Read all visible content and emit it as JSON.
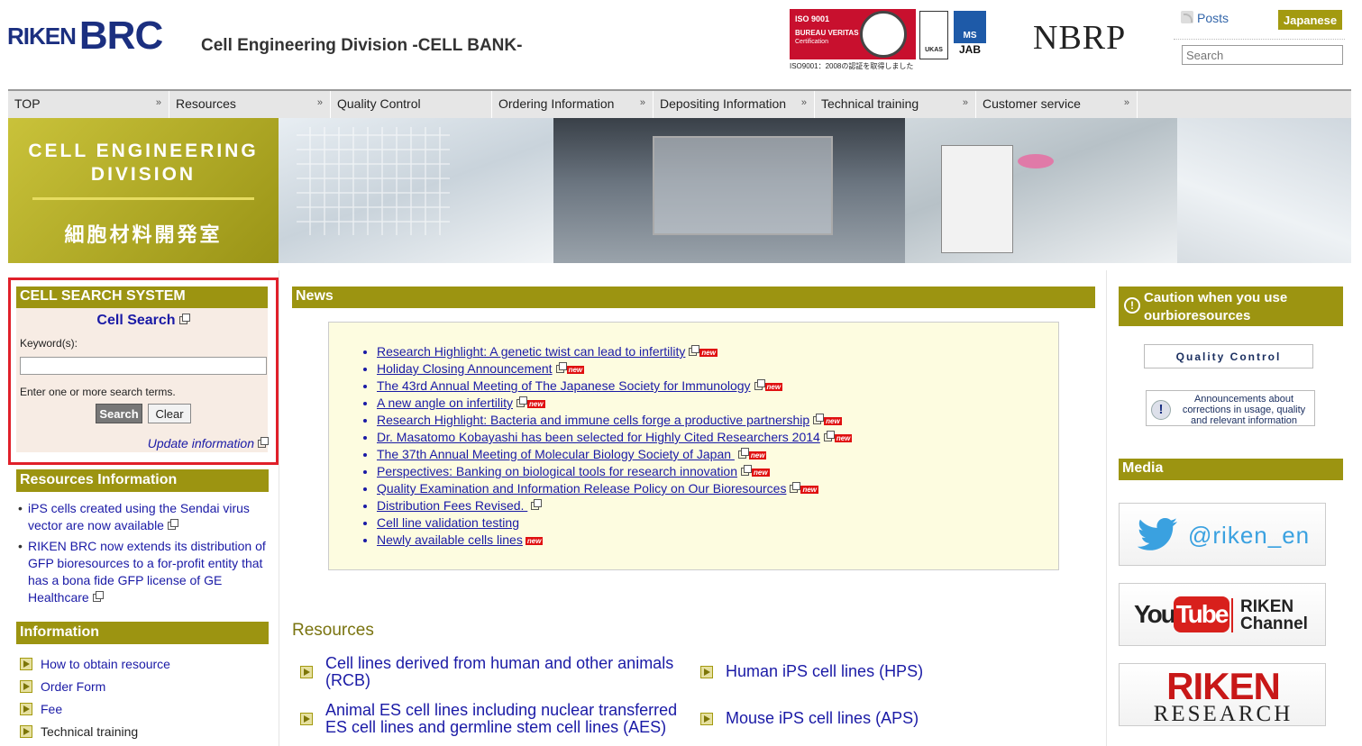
{
  "header": {
    "logo_riken": "RIKEN",
    "logo_brc": "BRC",
    "division": "Cell Engineering Division  -CELL BANK-",
    "cert": {
      "iso": "ISO 9001",
      "bv": "BUREAU VERITAS",
      "certification": "Certification",
      "ukas": "UKAS",
      "ms": "MS",
      "jab": "JAB",
      "caption": "ISO9001：2008の認証を取得しました"
    },
    "nbrp": "NBRP",
    "posts": "Posts",
    "japanese_button": "Japanese",
    "search_placeholder": "Search"
  },
  "nav": [
    "TOP",
    "Resources",
    "Quality Control",
    "Ordering Information",
    "Depositing Information",
    "Technical training",
    "Customer service"
  ],
  "banner": {
    "title_en_1": "CELL ENGINEERING",
    "title_en_2": "DIVISION",
    "title_jp": "細胞材料開発室"
  },
  "cell_search": {
    "heading": "CELL SEARCH SYSTEM",
    "title": "Cell Search",
    "keyword_label": "Keyword(s):",
    "keyword_value": "",
    "hint": "Enter one or more search terms.",
    "search_button": "Search",
    "clear_button": "Clear",
    "update_link": "Update information"
  },
  "resources_info": {
    "heading": "Resources Information",
    "items": [
      "iPS cells created using the Sendai virus vector are now available",
      "RIKEN BRC now extends its distribution of GFP bioresources to a for-profit entity that has a bona fide GFP license of GE Healthcare"
    ]
  },
  "information": {
    "heading": "Information",
    "items": [
      "How to obtain resource",
      "Order Form",
      "Fee",
      "Technical training"
    ]
  },
  "news": {
    "heading": "News",
    "new_badge": "new",
    "items": [
      {
        "text": "Research Highlight: A genetic twist can lead to infertility",
        "new": true
      },
      {
        "text": "Holiday Closing Announcement",
        "new": true
      },
      {
        "text": "The 43rd Annual Meeting of The Japanese Society for Immunology",
        "new": true
      },
      {
        "text": "A new angle on infertility",
        "new": true
      },
      {
        "text": "Research Highlight: Bacteria and immune cells forge a productive partnership",
        "new": true
      },
      {
        "text": "Dr. Masatomo Kobayashi has been selected for Highly Cited Researchers 2014",
        "new": true
      },
      {
        "text": "The 37th Annual Meeting of Molecular Biology Society of Japan ",
        "new": true
      },
      {
        "text": "Perspectives: Banking on biological tools for research innovation",
        "new": true
      },
      {
        "text": "Quality Examination and Information Release Policy on Our Bioresources",
        "new": true
      },
      {
        "text": "Distribution Fees Revised. ",
        "new": false
      },
      {
        "text": "Cell line validation testing",
        "new": false,
        "noext": true
      },
      {
        "text": "Newly available cells lines",
        "new": true,
        "noext": true
      }
    ]
  },
  "resources": {
    "heading": "Resources",
    "items": [
      "Cell lines derived from human and other animals (RCB)",
      "Human iPS cell lines (HPS)",
      "Animal ES cell lines including nuclear transferred ES cell lines and germline stem cell lines (AES)",
      "Mouse iPS cell lines (APS)"
    ]
  },
  "right": {
    "caution_heading": "Caution when you use ourbioresources",
    "quality_control_button": "Quality Control",
    "announcement": "Announcements about corrections in usage, quality and relevant information",
    "media_heading": "Media",
    "twitter_handle": "@riken_en",
    "youtube_you": "You",
    "youtube_tube": "Tube",
    "youtube_channel_1": "RIKEN",
    "youtube_channel_2": "Channel",
    "riken_research_1": "RIKEN",
    "riken_research_2": "RESEARCH"
  },
  "colors": {
    "accent": "#9c9411",
    "link": "#1a1aa6",
    "highlight_border": "#e0202a"
  }
}
